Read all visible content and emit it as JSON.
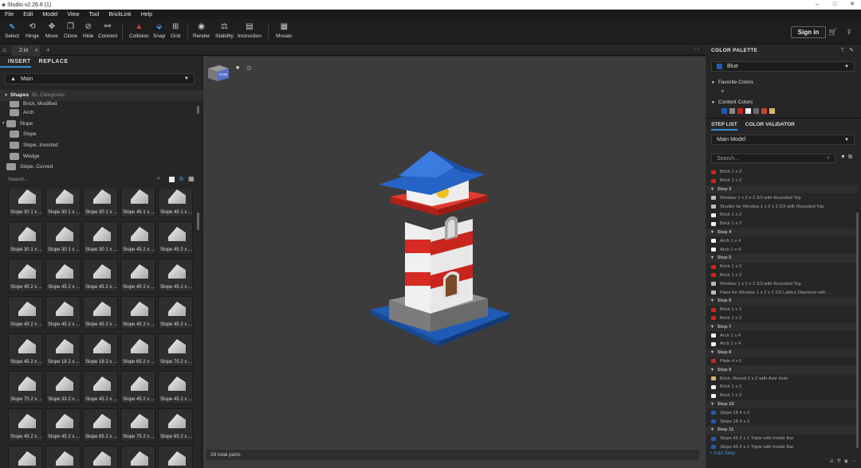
{
  "window": {
    "title": "Studio v2.26.6 (1)",
    "controls": [
      "–",
      "□",
      "✕"
    ]
  },
  "menu": [
    "File",
    "Edit",
    "Model",
    "View",
    "Tool",
    "BrickLink",
    "Help"
  ],
  "toolbar": {
    "tools": [
      {
        "label": "Select",
        "icon": "cursor-icon",
        "glyph": "⬉"
      },
      {
        "label": "Hinge",
        "icon": "hinge-icon",
        "glyph": "⟲"
      },
      {
        "label": "Move",
        "icon": "move-icon",
        "glyph": "✥"
      },
      {
        "label": "Clone",
        "icon": "clone-icon",
        "glyph": "❐"
      },
      {
        "label": "Hide",
        "icon": "hide-icon",
        "glyph": "⊘"
      },
      {
        "label": "Connect",
        "icon": "connect-icon",
        "glyph": "⚯"
      },
      {
        "label": "Collision",
        "icon": "collision-icon",
        "glyph": "▲"
      },
      {
        "label": "Snap",
        "icon": "snap-icon",
        "glyph": "⬙"
      },
      {
        "label": "Grid",
        "icon": "grid-icon",
        "glyph": "⊞"
      },
      {
        "label": "Render",
        "icon": "camera-icon",
        "glyph": "◉"
      },
      {
        "label": "Stability",
        "icon": "stability-icon",
        "glyph": "⚖"
      },
      {
        "label": "Instruction",
        "icon": "instruction-icon",
        "glyph": "▤"
      },
      {
        "label": "Mosaic",
        "icon": "mosaic-icon",
        "glyph": "▦"
      }
    ],
    "signin": "Sign in",
    "collision_color": "#e03a3a",
    "accent": "#3a8fd6"
  },
  "tabs": {
    "file_tab": "2.io",
    "close": "✕",
    "add": "+",
    "nav": "‹ ›"
  },
  "left": {
    "tabs": [
      "INSERT",
      "REPLACE"
    ],
    "palette_select": "Main",
    "tree": {
      "header": "Shapes",
      "header_sub": "BL Categories",
      "items": [
        "Brick, Modified",
        "Arch",
        "Slope",
        "Slope",
        "Slope, Inverted",
        "Wedge",
        "Slope, Curved"
      ]
    },
    "search_placeholder": "Search...",
    "parts": [
      "Slope 30 1 x ...",
      "Slope 30 1 x ...",
      "Slope 30 1 x ...",
      "Slope 45 1 x ...",
      "Slope 45 1 x ...",
      "Slope 30 1 x ...",
      "Slope 30 1 x ...",
      "Slope 30 1 x ...",
      "Slope 45 2 x ...",
      "Slope 45 2 x ...",
      "Slope 45 2 x ...",
      "Slope 45 2 x ...",
      "Slope 45 2 x ...",
      "Slope 45 2 x ...",
      "Slope 45 2 x ...",
      "Slope 45 2 x ...",
      "Slope 45 2 x ...",
      "Slope 45 2 x ...",
      "Slope 45 2 x ...",
      "Slope 45 2 x ...",
      "Slope 45 2 x ...",
      "Slope 18 2 x ...",
      "Slope 18 2 x ...",
      "Slope 65 2 x ...",
      "Slope 75 2 x ...",
      "Slope 75 2 x ...",
      "Slope 33 2 x ...",
      "Slope 45 2 x ...",
      "Slope 45 2 x ...",
      "Slope 45 2 x ...",
      "Slope 45 2 x ...",
      "Slope 45 2 x ...",
      "Slope 65 2 x ...",
      "Slope 75 2 x ...",
      "Slope 65 2 x ...",
      "",
      "",
      "",
      "",
      ""
    ]
  },
  "viewport": {
    "status": "28 total parts",
    "cube_label": "Front"
  },
  "right": {
    "color_palette": {
      "title": "COLOR PALETTE",
      "selected": "Blue",
      "selected_color": "#1f5bb5",
      "favorite_title": "Favorite Colors",
      "add": "+",
      "content_title": "Content Colors",
      "content_colors": [
        "#1f5bb5",
        "#8a8a8a",
        "#c8251d",
        "#f2f2f2",
        "#6b6b6b",
        "#c24a2a",
        "#d9b86a"
      ]
    },
    "step_tabs": [
      "STEP LIST",
      "COLOR VALIDATOR"
    ],
    "model_select": "Main Model",
    "search_placeholder": "Search...",
    "steps": [
      {
        "type": "item",
        "color": "#c8251d",
        "label": "Brick 1 x 2"
      },
      {
        "type": "item",
        "color": "#c8251d",
        "label": "Brick 1 x 2"
      },
      {
        "type": "head",
        "label": "Step 3"
      },
      {
        "type": "item",
        "color": "#bdbdbd",
        "label": "Window 1 x 2 x 2 2/3 with Rounded Top"
      },
      {
        "type": "item",
        "color": "#bdbdbd",
        "label": "Shutter for Window 1 x 2 x 2 2/3 with Rounded Top"
      },
      {
        "type": "item",
        "color": "#f2f2f2",
        "label": "Brick 1 x 2"
      },
      {
        "type": "item",
        "color": "#f2f2f2",
        "label": "Brick 1 x 2"
      },
      {
        "type": "head",
        "label": "Step 4"
      },
      {
        "type": "item",
        "color": "#f2f2f2",
        "label": "Arch 1 x 4"
      },
      {
        "type": "item",
        "color": "#f2f2f2",
        "label": "Arch 1 x 4"
      },
      {
        "type": "head",
        "label": "Step 5"
      },
      {
        "type": "item",
        "color": "#c8251d",
        "label": "Brick 1 x 2"
      },
      {
        "type": "item",
        "color": "#c8251d",
        "label": "Brick 1 x 2"
      },
      {
        "type": "item",
        "color": "#bdbdbd",
        "label": "Window 1 x 2 x 2 2/3 with Rounded Top"
      },
      {
        "type": "item",
        "color": "#bdbdbd",
        "label": "Pane for Window 1 x 2 x 2 2/3 Lattice Diamond with ..."
      },
      {
        "type": "head",
        "label": "Step 6"
      },
      {
        "type": "item",
        "color": "#c8251d",
        "label": "Brick 1 x 2"
      },
      {
        "type": "item",
        "color": "#c8251d",
        "label": "Brick 1 x 2"
      },
      {
        "type": "head",
        "label": "Step 7"
      },
      {
        "type": "item",
        "color": "#f2f2f2",
        "label": "Arch 1 x 4"
      },
      {
        "type": "item",
        "color": "#f2f2f2",
        "label": "Arch 1 x 4"
      },
      {
        "type": "head",
        "label": "Step 8"
      },
      {
        "type": "item",
        "color": "#c8251d",
        "label": "Plate 4 x 6"
      },
      {
        "type": "head",
        "label": "Step 9"
      },
      {
        "type": "item",
        "color": "#d9b86a",
        "label": "Brick, Round 2 x 2 with Axle Hole"
      },
      {
        "type": "item",
        "color": "#f2f2f2",
        "label": "Brick 1 x 2"
      },
      {
        "type": "item",
        "color": "#f2f2f2",
        "label": "Brick 1 x 2"
      },
      {
        "type": "head",
        "label": "Step 10"
      },
      {
        "type": "item",
        "color": "#1f5bb5",
        "label": "Slope 18 4 x 2"
      },
      {
        "type": "item",
        "color": "#1f5bb5",
        "label": "Slope 18 4 x 2"
      },
      {
        "type": "head",
        "label": "Step 11"
      },
      {
        "type": "item",
        "color": "#1f5bb5",
        "label": "Slope 45 2 x 1 Triple with Inside Bar"
      },
      {
        "type": "item",
        "color": "#1f5bb5",
        "label": "Slope 45 2 x 1 Triple with Inside Bar"
      }
    ],
    "add_step": "+ Add Step"
  }
}
